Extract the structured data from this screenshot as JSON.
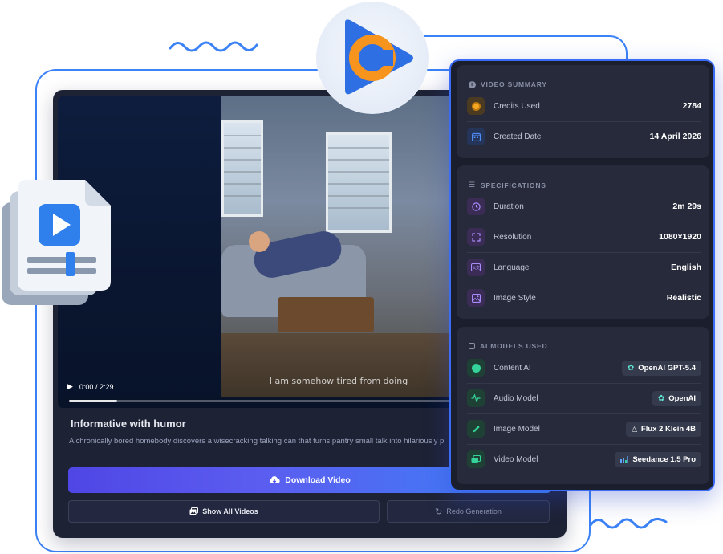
{
  "video": {
    "time_display": "0:00 / 2:29",
    "caption": "I am somehow tired from doing",
    "title": "Informative with humor",
    "description": "A chronically bored homebody discovers a wisecracking talking can that turns pantry small talk into hilariously p",
    "progress_fraction": 0.1
  },
  "actions": {
    "download_label": "Download Video",
    "show_all_label": "Show All Videos",
    "redo_label": "Redo Generation"
  },
  "summary": {
    "title": "VIDEO SUMMARY",
    "credits_label": "Credits Used",
    "credits_value": "2784",
    "date_label": "Created Date",
    "date_value": "14 April 2026"
  },
  "specs": {
    "title": "SPECIFICATIONS",
    "duration_label": "Duration",
    "duration_value": "2m 29s",
    "resolution_label": "Resolution",
    "resolution_value": "1080×1920",
    "language_label": "Language",
    "language_value": "English",
    "style_label": "Image Style",
    "style_value": "Realistic"
  },
  "models": {
    "title": "AI MODELS USED",
    "content_label": "Content AI",
    "content_value": "OpenAI GPT-5.4",
    "audio_label": "Audio Model",
    "audio_value": "OpenAI",
    "image_label": "Image Model",
    "image_value": "Flux 2 Klein 4B",
    "video_label": "Video Model",
    "video_value": "Seedance 1.5 Pro"
  },
  "colors": {
    "accent_blue": "#3b82f6",
    "accent_indigo": "#4f46e5",
    "logo_orange": "#f7941d",
    "panel_bg": "#1b1e2c"
  }
}
